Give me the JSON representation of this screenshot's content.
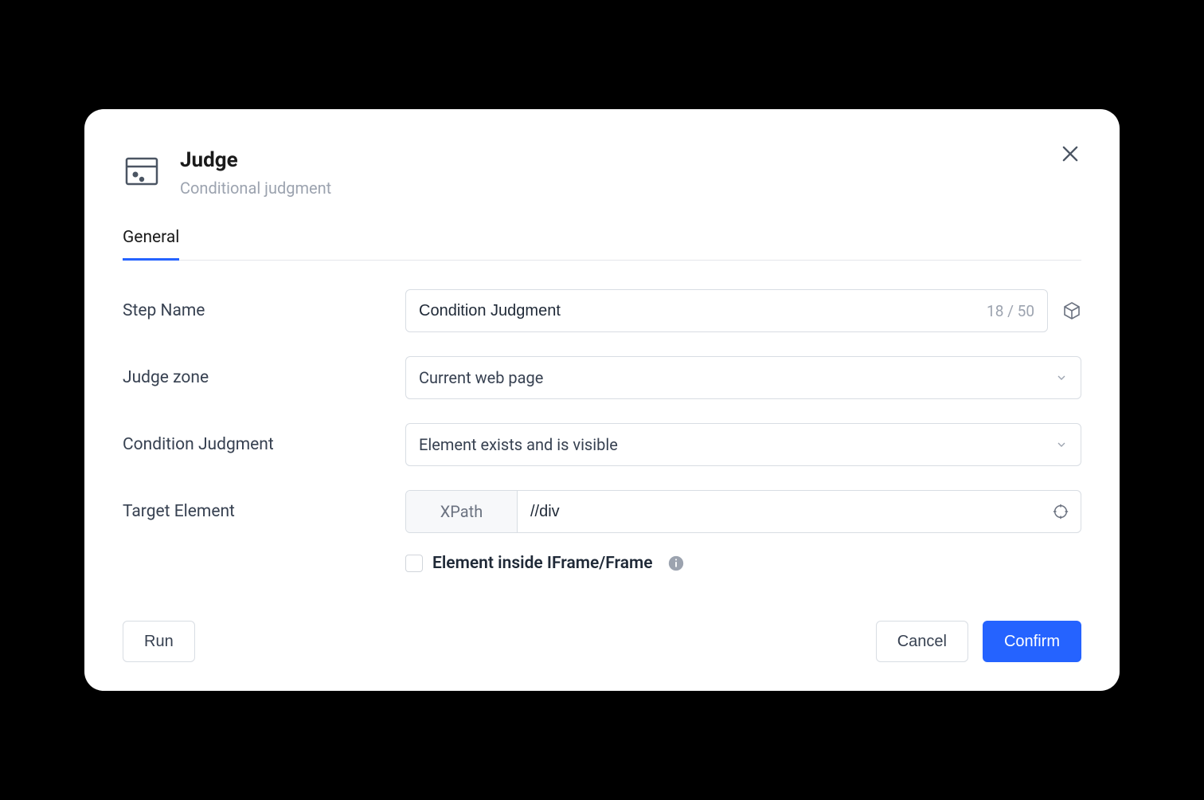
{
  "header": {
    "title": "Judge",
    "subtitle": "Conditional judgment"
  },
  "tabs": {
    "general": "General"
  },
  "labels": {
    "step_name": "Step Name",
    "judge_zone": "Judge zone",
    "condition_judgment": "Condition Judgment",
    "target_element": "Target Element"
  },
  "step_name": {
    "value": "Condition Judgment",
    "count": "18 / 50"
  },
  "judge_zone": {
    "value": "Current web page"
  },
  "condition": {
    "value": "Element exists and is visible"
  },
  "target": {
    "prefix": "XPath",
    "value": "//div"
  },
  "iframe_checkbox": {
    "label": "Element inside IFrame/Frame",
    "checked": false
  },
  "footer": {
    "run": "Run",
    "cancel": "Cancel",
    "confirm": "Confirm"
  }
}
